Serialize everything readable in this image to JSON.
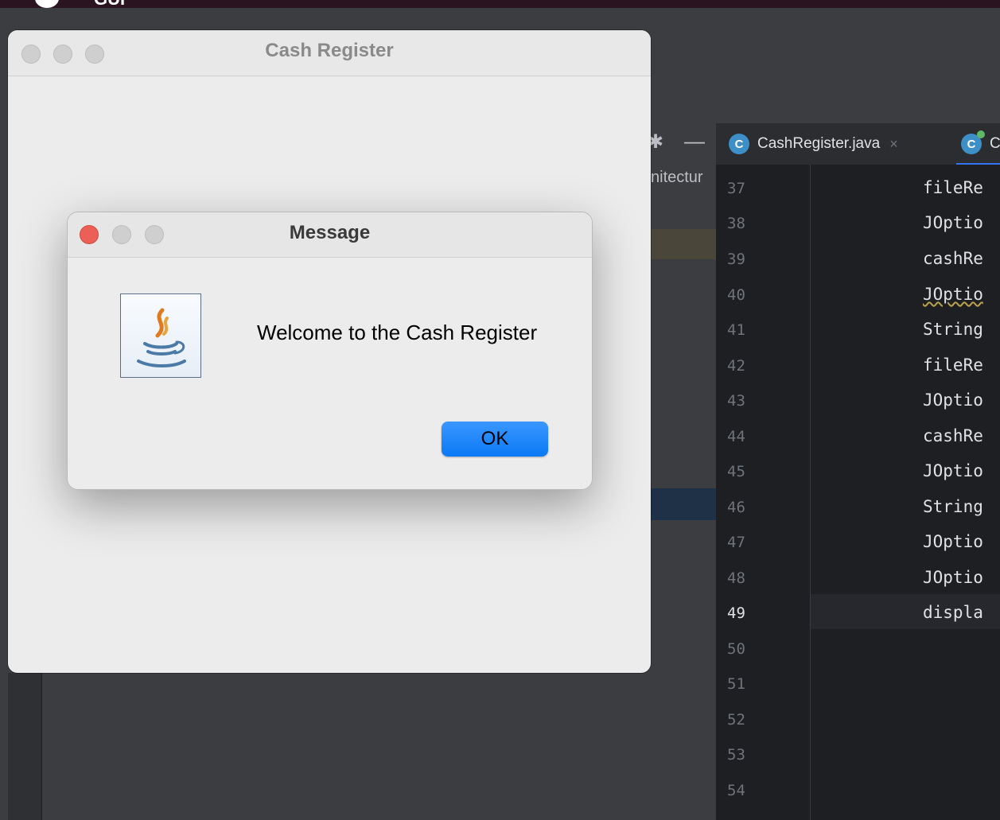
{
  "menubar": {
    "app_name": "GUI"
  },
  "ide": {
    "panel_text": "nitectur",
    "tabs": [
      {
        "label": "CashRegister.java",
        "icon": "class-icon",
        "close": "×"
      },
      {
        "label": "C",
        "icon": "class-run-icon"
      }
    ],
    "line_numbers": [
      "37",
      "38",
      "39",
      "40",
      "41",
      "42",
      "43",
      "44",
      "45",
      "46",
      "47",
      "48",
      "49",
      "50",
      "51",
      "52",
      "53",
      "54"
    ],
    "current_line": "49",
    "code_lines": [
      "fileRe",
      "JOptio",
      "cashRe",
      "JOptio",
      "String",
      "fileRe",
      "JOptio",
      "cashRe",
      "JOptio",
      "String",
      "JOptio",
      "JOptio",
      "displa"
    ]
  },
  "cash_window": {
    "title": "Cash Register"
  },
  "message_dialog": {
    "title": "Message",
    "text": "Welcome to the Cash Register",
    "ok_label": "OK",
    "icon": "java-icon"
  },
  "colors": {
    "ok_button": "#0a79f5",
    "close_red": "#ec5f57",
    "editor_bg": "#1e1f22"
  }
}
